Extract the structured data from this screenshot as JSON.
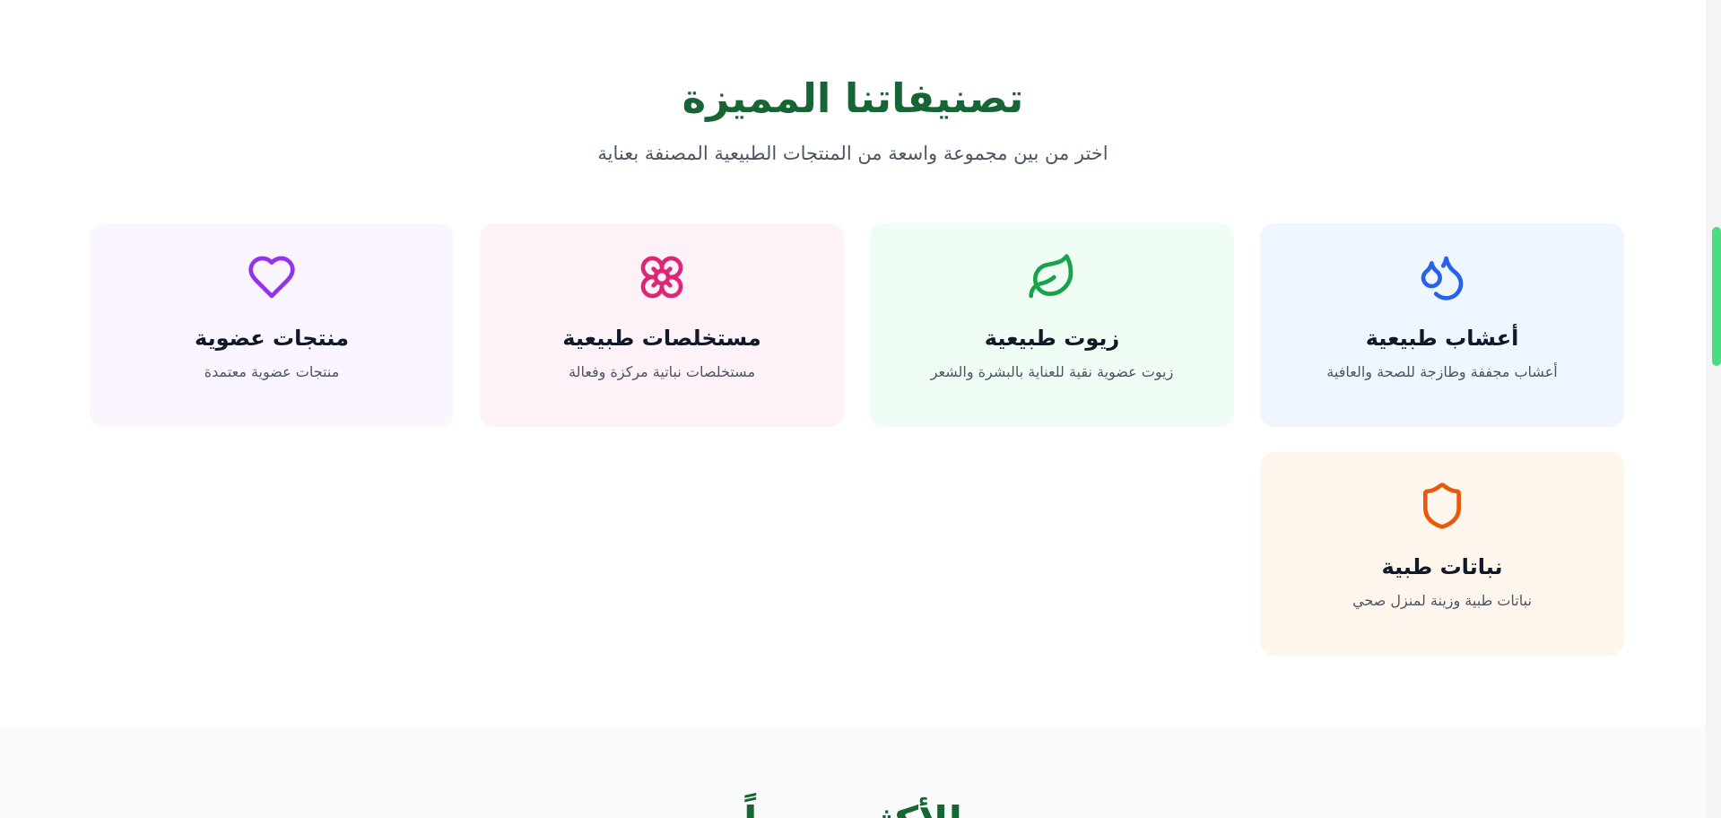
{
  "categories_section": {
    "title": "تصنيفاتنا المميزة",
    "subtitle": "اختر من بين مجموعة واسعة من المنتجات الطبيعية المصنفة بعناية",
    "cards": [
      {
        "title": "أعشاب طبيعية",
        "description": "أعشاب مجففة وطازجة للصحة والعافية",
        "icon": "droplets-icon",
        "color": "#2563eb",
        "background": "#eff6ff"
      },
      {
        "title": "زيوت طبيعية",
        "description": "زيوت عضوية نقية للعناية بالبشرة والشعر",
        "icon": "leaf-icon",
        "color": "#16a34a",
        "background": "#f0fdf4"
      },
      {
        "title": "مستخلصات طبيعية",
        "description": "مستخلصات نباتية مركزة وفعالة",
        "icon": "flower-icon",
        "color": "#db2777",
        "background": "#fdf2f8"
      },
      {
        "title": "منتجات عضوية",
        "description": "منتجات عضوية معتمدة",
        "icon": "heart-icon",
        "color": "#9333ea",
        "background": "#faf5ff"
      },
      {
        "title": "نباتات طبية",
        "description": "نباتات طبية وزينة لمنزل صحي",
        "icon": "shield-icon",
        "color": "#ea580c",
        "background": "#fff7ed"
      }
    ]
  },
  "next_section": {
    "title": "الأكثر مبيعاً"
  },
  "theme": {
    "accent": "#166534",
    "scrollbar_thumb": "#4ade80"
  }
}
